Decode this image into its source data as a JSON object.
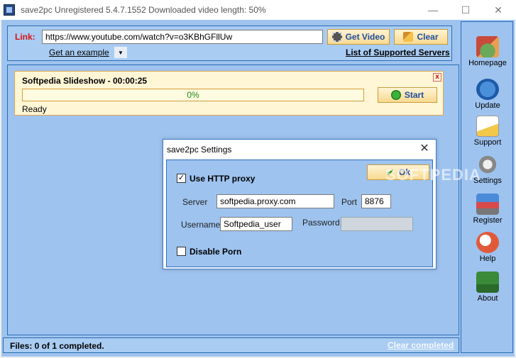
{
  "window": {
    "title": "save2pc Unregistered  5.4.7.1552 Downloaded video length: 50%",
    "min_glyph": "—",
    "max_glyph": "☐",
    "close_glyph": "✕"
  },
  "link_panel": {
    "label": "Link:",
    "url_value": "https://www.youtube.com/watch?v=o3KBhGFllUw",
    "get_video_label": "Get Video",
    "clear_label": "Clear",
    "example_link": "Get an example",
    "example_dropdown_glyph": "▼",
    "supported_servers_link": "List of Supported Servers"
  },
  "download": {
    "title": "Softpedia Slideshow - 00:00:25",
    "close_glyph": "x",
    "progress": 0,
    "progress_text": "0%",
    "start_label": "Start",
    "status": "Ready"
  },
  "statusbar": {
    "files_text": "Files: 0 of 1 completed.",
    "clear_completed": "Clear completed"
  },
  "sidebar": {
    "items": [
      {
        "label": "Homepage",
        "icon": "home-icon"
      },
      {
        "label": "Update",
        "icon": "update-globe-icon"
      },
      {
        "label": "Support",
        "icon": "support-notepad-icon"
      },
      {
        "label": "Settings",
        "icon": "gear-icon"
      },
      {
        "label": "Register",
        "icon": "cart-icon"
      },
      {
        "label": "Help",
        "icon": "help-icon"
      },
      {
        "label": "About",
        "icon": "about-icon"
      }
    ]
  },
  "settings_dialog": {
    "title": "save2pc Settings",
    "close_glyph": "✕",
    "use_proxy_label": "Use HTTP proxy",
    "use_proxy_checked": true,
    "check_glyph": "✓",
    "ok_label": "Ok",
    "ok_glyph": "✔",
    "server_label": "Server",
    "server_value": "softpedia.proxy.com",
    "port_label": "Port",
    "port_value": "8876",
    "username_label": "Username",
    "username_value": "Softpedia_user",
    "password_label": "Password",
    "password_value": "",
    "disable_porn_label": "Disable Porn",
    "disable_porn_checked": false
  },
  "watermark": "SOFTPEDIA"
}
